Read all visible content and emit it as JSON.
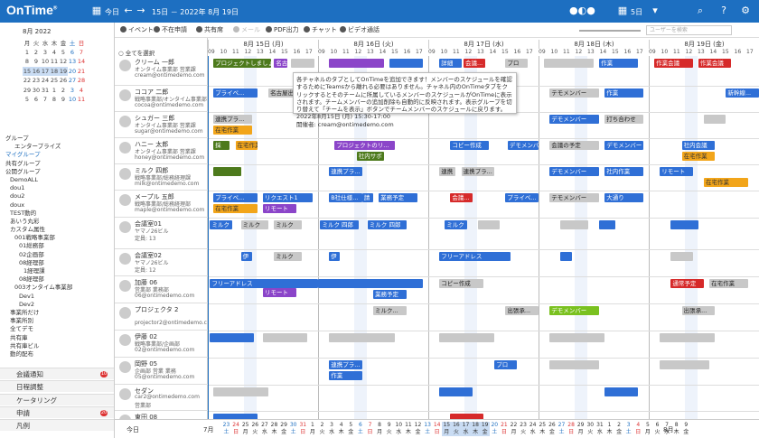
{
  "header": {
    "logo": "OnTime",
    "logo_mark": "®",
    "today": "今日",
    "range": "15日 － 2022年 8月 19日",
    "days": "5日"
  },
  "colors": {
    "header": "#1d6fc1",
    "blue": "#2f6fd6",
    "green": "#4d7a1c",
    "gray": "#999999",
    "red": "#d62a2a",
    "purple": "#8b45c9",
    "orange": "#f2a51a",
    "cyan": "#24a1cf",
    "lime": "#7ac11f"
  },
  "mini_cal": {
    "title": "8月 2022",
    "weekdays": [
      "月",
      "火",
      "水",
      "木",
      "金",
      "土",
      "日"
    ],
    "weeks": [
      [
        "1",
        "2",
        "3",
        "4",
        "5",
        "6",
        "7"
      ],
      [
        "8",
        "9",
        "10",
        "11",
        "12",
        "13",
        "14"
      ],
      [
        "15",
        "16",
        "17",
        "18",
        "19",
        "20",
        "21"
      ],
      [
        "22",
        "23",
        "24",
        "25",
        "26",
        "27",
        "28"
      ],
      [
        "29",
        "30",
        "31",
        "1",
        "2",
        "3",
        "4"
      ],
      [
        "5",
        "6",
        "7",
        "8",
        "9",
        "10",
        "11"
      ]
    ]
  },
  "tree": [
    {
      "t": "グループ",
      "i": 0
    },
    {
      "t": "エンタープライズ",
      "i": 2
    },
    {
      "t": "マイグループ",
      "i": 0
    },
    {
      "t": "共有グループ",
      "i": 0
    },
    {
      "t": "公開グループ",
      "i": 0
    },
    {
      "t": "DemoALL",
      "i": 1
    },
    {
      "t": "dou1",
      "i": 1
    },
    {
      "t": "dou2",
      "i": 1
    },
    {
      "t": "doux",
      "i": 1
    },
    {
      "t": "TEST動的",
      "i": 1
    },
    {
      "t": "あいう丸彩",
      "i": 1
    },
    {
      "t": "カスタム属性",
      "i": 1
    },
    {
      "t": "001戦略事業部",
      "i": 2
    },
    {
      "t": "01総務部",
      "i": 3
    },
    {
      "t": "02企画部",
      "i": 3
    },
    {
      "t": "08経理部",
      "i": 3
    },
    {
      "t": "1経理課",
      "i": 4
    },
    {
      "t": "08経理部",
      "i": 3
    },
    {
      "t": "003オンタイム事業部",
      "i": 2
    },
    {
      "t": "Dev1",
      "i": 3
    },
    {
      "t": "Dev2",
      "i": 3
    },
    {
      "t": "事業所だけ",
      "i": 1
    },
    {
      "t": "事業所別",
      "i": 1
    },
    {
      "t": "全てデモ",
      "i": 1
    },
    {
      "t": "共有庫",
      "i": 1
    },
    {
      "t": "共有庫ビル",
      "i": 1
    },
    {
      "t": "動的配布",
      "i": 1
    }
  ],
  "panels": [
    {
      "label": "会議通知",
      "badge": "10"
    },
    {
      "label": "日程調整",
      "badge": ""
    },
    {
      "label": "ケータリング",
      "badge": ""
    },
    {
      "label": "申請",
      "badge": "20"
    },
    {
      "label": "凡例",
      "badge": ""
    }
  ],
  "toolbar": {
    "event": "イベント",
    "absent": "不在申請",
    "shared": "共有席",
    "mail": "メール",
    "pdf": "PDF出力",
    "chat": "チャット",
    "video": "ビデオ通話",
    "search_placeholder": "ユーザーを検索"
  },
  "select_all": "全てを選択",
  "days": [
    "8月 15日 (月)",
    "8月 16日 (火)",
    "8月 17日 (水)",
    "8月 18日 (木)",
    "8月 19日 (金)"
  ],
  "hours": [
    "09",
    "10",
    "11",
    "12",
    "13",
    "14",
    "15",
    "16",
    "17"
  ],
  "users": [
    {
      "name": "クリーム 一郎",
      "sub1": "オンタイム事業部 営業課",
      "sub2": "cream@ontimedemo.com"
    },
    {
      "name": "ココア 二郎",
      "sub1": "戦略事業部/オンタイム事業部",
      "sub2": "cocoa@ontimedemo.com"
    },
    {
      "name": "シュガー 三郎",
      "sub1": "オンタイム事業部 営業課",
      "sub2": "sugar@ontimedemo.com"
    },
    {
      "name": "ハニー 太郎",
      "sub1": "オンタイム事業部 営業課",
      "sub2": "honey@ontimedemo.com"
    },
    {
      "name": "ミルク 四郎",
      "sub1": "戦略事業部/総務経理課",
      "sub2": "milk@ontimedemo.com"
    },
    {
      "name": "メープル 五郎",
      "sub1": "戦略事業部/総務経理部",
      "sub2": "maple@ontimedemo.com"
    },
    {
      "name": "会議室01",
      "sub1": "ヤマノ26ビル",
      "sub2": "定員: 13"
    },
    {
      "name": "会議室02",
      "sub1": "ヤマノ26ビル",
      "sub2": "定員: 12"
    },
    {
      "name": "加藤 06",
      "sub1": "営業部 業務部",
      "sub2": "06@ontimedemo.com"
    },
    {
      "name": "プロジェクタ 2",
      "sub1": "",
      "sub2": "projector2@ontimedemo.com"
    },
    {
      "name": "伊藤 02",
      "sub1": "戦略事業部/企画部",
      "sub2": "02@ontimedemo.com"
    },
    {
      "name": "岡野 05",
      "sub1": "企画部 営業 業務",
      "sub2": "05@ontimedemo.com"
    },
    {
      "name": "セダン",
      "sub1": "car2@ontimedemo.com",
      "sub2": "営業部"
    },
    {
      "name": "東田 08",
      "sub1": "",
      "sub2": ""
    }
  ],
  "events": [
    {
      "u": 0,
      "d": 0,
      "s": 0.05,
      "w": 0.52,
      "c": "green",
      "t": "プロジェクトしましょう"
    },
    {
      "u": 0,
      "d": 0,
      "s": 0.6,
      "w": 0.12,
      "c": "purple",
      "t": "名古..."
    },
    {
      "u": 0,
      "d": 0,
      "s": 0.75,
      "w": 0.22,
      "c": "gray",
      "t": ""
    },
    {
      "u": 0,
      "d": 1,
      "s": 0.1,
      "w": 0.5,
      "c": "purple",
      "t": ""
    },
    {
      "u": 0,
      "d": 1,
      "s": 0.65,
      "w": 0.3,
      "c": "blue",
      "t": ""
    },
    {
      "u": 0,
      "d": 2,
      "s": 0.1,
      "w": 0.2,
      "c": "blue",
      "t": "詳細"
    },
    {
      "u": 0,
      "d": 2,
      "s": 0.32,
      "w": 0.2,
      "c": "red",
      "t": "会議..."
    },
    {
      "u": 0,
      "d": 2,
      "s": 0.7,
      "w": 0.2,
      "c": "gray",
      "t": "プロ"
    },
    {
      "u": 0,
      "d": 3,
      "s": 0.05,
      "w": 0.45,
      "c": "gray",
      "t": ""
    },
    {
      "u": 0,
      "d": 3,
      "s": 0.55,
      "w": 0.35,
      "c": "blue",
      "t": "作業"
    },
    {
      "u": 0,
      "d": 4,
      "s": 0.05,
      "w": 0.35,
      "c": "red",
      "t": "作業会議"
    },
    {
      "u": 0,
      "d": 4,
      "s": 0.45,
      "w": 0.3,
      "c": "red",
      "t": "作業会議"
    },
    {
      "u": 1,
      "d": 0,
      "s": 0.05,
      "w": 0.4,
      "c": "blue",
      "t": "プライベ..."
    },
    {
      "u": 1,
      "d": 0,
      "s": 0.55,
      "w": 0.3,
      "c": "gray",
      "t": "名古屋出張"
    },
    {
      "u": 1,
      "d": 3,
      "s": 0.1,
      "w": 0.45,
      "c": "gray",
      "t": "テモメンバー"
    },
    {
      "u": 1,
      "d": 3,
      "s": 0.6,
      "w": 0.35,
      "c": "blue",
      "t": "作業"
    },
    {
      "u": 1,
      "d": 4,
      "s": 0.7,
      "w": 0.3,
      "c": "blue",
      "t": "新幹線..."
    },
    {
      "u": 2,
      "d": 0,
      "s": 0.05,
      "w": 0.35,
      "c": "gray",
      "t": "連携プラ..."
    },
    {
      "u": 2,
      "d": 0,
      "s": 0.05,
      "w": 0.35,
      "c": "orange",
      "t": "在宅作業",
      "o": 12
    },
    {
      "u": 2,
      "d": 3,
      "s": 0.1,
      "w": 0.45,
      "c": "blue",
      "t": "デモメンバー"
    },
    {
      "u": 2,
      "d": 3,
      "s": 0.6,
      "w": 0.35,
      "c": "gray",
      "t": "打ち合わせ"
    },
    {
      "u": 2,
      "d": 4,
      "s": 0.5,
      "w": 0.2,
      "c": "gray",
      "t": ""
    },
    {
      "u": 3,
      "d": 0,
      "s": 0.05,
      "w": 0.15,
      "c": "green",
      "t": "採"
    },
    {
      "u": 3,
      "d": 0,
      "s": 0.25,
      "w": 0.2,
      "c": "orange",
      "t": "在宅作業"
    },
    {
      "u": 3,
      "d": 1,
      "s": 0.15,
      "w": 0.55,
      "c": "purple",
      "t": "プロジェクトのリ..."
    },
    {
      "u": 3,
      "d": 1,
      "s": 0.35,
      "w": 0.25,
      "c": "green",
      "t": "社内サポ",
      "o": 12
    },
    {
      "u": 3,
      "d": 2,
      "s": 0.2,
      "w": 0.35,
      "c": "blue",
      "t": "コピー作成"
    },
    {
      "u": 3,
      "d": 2,
      "s": 0.72,
      "w": 0.28,
      "c": "blue",
      "t": "デモメンバー"
    },
    {
      "u": 3,
      "d": 3,
      "s": 0.1,
      "w": 0.45,
      "c": "gray",
      "t": "会議の予定"
    },
    {
      "u": 3,
      "d": 3,
      "s": 0.6,
      "w": 0.35,
      "c": "blue",
      "t": "デモメンバー"
    },
    {
      "u": 3,
      "d": 4,
      "s": 0.3,
      "w": 0.3,
      "c": "blue",
      "t": "社内会議"
    },
    {
      "u": 3,
      "d": 4,
      "s": 0.3,
      "w": 0.3,
      "c": "orange",
      "t": "在宅作業",
      "o": 12
    },
    {
      "u": 4,
      "d": 0,
      "s": 0.05,
      "w": 0.25,
      "c": "green",
      "t": ""
    },
    {
      "u": 4,
      "d": 1,
      "s": 0.1,
      "w": 0.3,
      "c": "blue",
      "t": "連携プラ..."
    },
    {
      "u": 4,
      "d": 2,
      "s": 0.1,
      "w": 0.15,
      "c": "gray",
      "t": "連携"
    },
    {
      "u": 4,
      "d": 2,
      "s": 0.3,
      "w": 0.3,
      "c": "gray",
      "t": "連携プラ..."
    },
    {
      "u": 4,
      "d": 3,
      "s": 0.1,
      "w": 0.45,
      "c": "blue",
      "t": "デモメンバー"
    },
    {
      "u": 4,
      "d": 3,
      "s": 0.6,
      "w": 0.35,
      "c": "blue",
      "t": "社内作業"
    },
    {
      "u": 4,
      "d": 4,
      "s": 0.1,
      "w": 0.3,
      "c": "blue",
      "t": "リモート"
    },
    {
      "u": 4,
      "d": 4,
      "s": 0.5,
      "w": 0.4,
      "c": "orange",
      "t": "在宅作業",
      "o": 12
    },
    {
      "u": 5,
      "d": 0,
      "s": 0.05,
      "w": 0.4,
      "c": "blue",
      "t": "プライベ..."
    },
    {
      "u": 5,
      "d": 0,
      "s": 0.5,
      "w": 0.45,
      "c": "blue",
      "t": "リクエスト1"
    },
    {
      "u": 5,
      "d": 0,
      "s": 0.05,
      "w": 0.4,
      "c": "orange",
      "t": "在宅作業",
      "o": 12
    },
    {
      "u": 5,
      "d": 0,
      "s": 0.5,
      "w": 0.3,
      "c": "purple",
      "t": "リモート",
      "o": 12
    },
    {
      "u": 5,
      "d": 1,
      "s": 0.1,
      "w": 0.3,
      "c": "blue",
      "t": "B社仕様..."
    },
    {
      "u": 5,
      "d": 1,
      "s": 0.4,
      "w": 0.1,
      "c": "blue",
      "t": "請"
    },
    {
      "u": 5,
      "d": 1,
      "s": 0.55,
      "w": 0.35,
      "c": "blue",
      "t": "業務予定"
    },
    {
      "u": 5,
      "d": 2,
      "s": 0.2,
      "w": 0.2,
      "c": "red",
      "t": "会議..."
    },
    {
      "u": 5,
      "d": 2,
      "s": 0.7,
      "w": 0.3,
      "c": "blue",
      "t": "プライベ..."
    },
    {
      "u": 5,
      "d": 3,
      "s": 0.1,
      "w": 0.45,
      "c": "gray",
      "t": "テモメンバー"
    },
    {
      "u": 5,
      "d": 3,
      "s": 0.6,
      "w": 0.35,
      "c": "blue",
      "t": "大通り"
    },
    {
      "u": 6,
      "d": 0,
      "s": 0.02,
      "w": 0.2,
      "c": "blue",
      "t": "ミルク"
    },
    {
      "u": 6,
      "d": 0,
      "s": 0.3,
      "w": 0.25,
      "c": "gray",
      "t": "ミルク"
    },
    {
      "u": 6,
      "d": 0,
      "s": 0.6,
      "w": 0.25,
      "c": "gray",
      "t": "ミルク"
    },
    {
      "u": 6,
      "d": 1,
      "s": 0.02,
      "w": 0.35,
      "c": "blue",
      "t": "ミルク 四郎"
    },
    {
      "u": 6,
      "d": 1,
      "s": 0.45,
      "w": 0.35,
      "c": "blue",
      "t": "ミルク 四郎"
    },
    {
      "u": 6,
      "d": 2,
      "s": 0.15,
      "w": 0.2,
      "c": "blue",
      "t": "ミルク"
    },
    {
      "u": 6,
      "d": 2,
      "s": 0.45,
      "w": 0.2,
      "c": "gray",
      "t": ""
    },
    {
      "u": 6,
      "d": 3,
      "s": 0.2,
      "w": 0.25,
      "c": "gray",
      "t": ""
    },
    {
      "u": 6,
      "d": 3,
      "s": 0.55,
      "w": 0.15,
      "c": "blue",
      "t": ""
    },
    {
      "u": 6,
      "d": 4,
      "s": 0.2,
      "w": 0.25,
      "c": "blue",
      "t": ""
    },
    {
      "u": 7,
      "d": 0,
      "s": 0.3,
      "w": 0.1,
      "c": "blue",
      "t": "伊"
    },
    {
      "u": 7,
      "d": 0,
      "s": 0.6,
      "w": 0.25,
      "c": "gray",
      "t": "ミルク"
    },
    {
      "u": 7,
      "d": 1,
      "s": 0.1,
      "w": 0.1,
      "c": "blue",
      "t": "伊"
    },
    {
      "u": 7,
      "d": 2,
      "s": 0.1,
      "w": 0.65,
      "c": "blue",
      "t": "フリーアドレス"
    },
    {
      "u": 7,
      "d": 3,
      "s": 0.2,
      "w": 0.1,
      "c": "blue",
      "t": ""
    },
    {
      "u": 7,
      "d": 4,
      "s": 0.2,
      "w": 0.2,
      "c": "gray",
      "t": ""
    },
    {
      "u": 8,
      "d": 0,
      "s": 0.02,
      "w": 0.98,
      "c": "blue",
      "t": "フリーアドレス"
    },
    {
      "u": 8,
      "d": 1,
      "s": 0.0,
      "w": 0.95,
      "c": "blue",
      "t": ""
    },
    {
      "u": 8,
      "d": 2,
      "s": 0.1,
      "w": 0.4,
      "c": "gray",
      "t": "コピー作成"
    },
    {
      "u": 8,
      "d": 0,
      "s": 0.5,
      "w": 0.3,
      "c": "purple",
      "t": "リモート",
      "o": 10
    },
    {
      "u": 8,
      "d": 1,
      "s": 0.5,
      "w": 0.3,
      "c": "blue",
      "t": "業務予定",
      "o": 12
    },
    {
      "u": 8,
      "d": 4,
      "s": 0.2,
      "w": 0.3,
      "c": "red",
      "t": "通常予定"
    },
    {
      "u": 8,
      "d": 4,
      "s": 0.55,
      "w": 0.35,
      "c": "gray",
      "t": "在宅作業"
    },
    {
      "u": 9,
      "d": 1,
      "s": 0.5,
      "w": 0.3,
      "c": "gray",
      "t": "ミルク..."
    },
    {
      "u": 9,
      "d": 2,
      "s": 0.7,
      "w": 0.3,
      "c": "gray",
      "t": "出張承..."
    },
    {
      "u": 9,
      "d": 3,
      "s": 0.1,
      "w": 0.45,
      "c": "lime",
      "t": "デモメンバー"
    },
    {
      "u": 9,
      "d": 4,
      "s": 0.3,
      "w": 0.3,
      "c": "gray",
      "t": "出張承..."
    },
    {
      "u": 10,
      "d": 0,
      "s": 0.02,
      "w": 0.4,
      "c": "blue",
      "t": ""
    },
    {
      "u": 10,
      "d": 0,
      "s": 0.5,
      "w": 0.4,
      "c": "gray",
      "t": ""
    },
    {
      "u": 10,
      "d": 1,
      "s": 0.1,
      "w": 0.6,
      "c": "gray",
      "t": ""
    },
    {
      "u": 10,
      "d": 2,
      "s": 0.1,
      "w": 0.5,
      "c": "gray",
      "t": ""
    },
    {
      "u": 10,
      "d": 3,
      "s": 0.1,
      "w": 0.5,
      "c": "gray",
      "t": ""
    },
    {
      "u": 10,
      "d": 4,
      "s": 0.1,
      "w": 0.5,
      "c": "gray",
      "t": ""
    },
    {
      "u": 11,
      "d": 1,
      "s": 0.1,
      "w": 0.3,
      "c": "blue",
      "t": "連携プラ..."
    },
    {
      "u": 11,
      "d": 1,
      "s": 0.1,
      "w": 0.3,
      "c": "blue",
      "t": "作業",
      "o": 12
    },
    {
      "u": 11,
      "d": 2,
      "s": 0.6,
      "w": 0.2,
      "c": "blue",
      "t": "プロ"
    },
    {
      "u": 11,
      "d": 3,
      "s": 0.1,
      "w": 0.45,
      "c": "gray",
      "t": ""
    },
    {
      "u": 11,
      "d": 4,
      "s": 0.1,
      "w": 0.45,
      "c": "gray",
      "t": ""
    },
    {
      "u": 12,
      "d": 0,
      "s": 0.05,
      "w": 0.5,
      "c": "gray",
      "t": ""
    },
    {
      "u": 12,
      "d": 2,
      "s": 0.1,
      "w": 0.3,
      "c": "blue",
      "t": ""
    },
    {
      "u": 12,
      "d": 3,
      "s": 0.6,
      "w": 0.3,
      "c": "blue",
      "t": ""
    },
    {
      "u": 13,
      "d": 0,
      "s": 0.05,
      "w": 0.4,
      "c": "blue",
      "t": ""
    },
    {
      "u": 13,
      "d": 2,
      "s": 0.2,
      "w": 0.3,
      "c": "red",
      "t": ""
    }
  ],
  "tooltip": {
    "line1": "各チャネルのタブとしてOnTimeを追加できます！メンバーのスケジュールを確認するためにTeamsから離れる必要はありません。チャネル内のOnTimeタブをクリックするとそのチームに所属しているメンバーのスケジュールがOnTimeに表示されます。チームメンバーの追加削除も自動的に反映されます。表示グループを切り替えて「チームを表示」ボタンでチームメンバーのスケジュールに戻ります。",
    "line2": "2022年8月15日 (月) 15:30-17:00",
    "line3": "開催者: cream@ontimedemo.com"
  },
  "footer": {
    "today": "今日",
    "month1": "7月",
    "month2": "8月",
    "dates": [
      {
        "d": "23",
        "w": "土"
      },
      {
        "d": "24",
        "w": "日"
      },
      {
        "d": "25",
        "w": "月"
      },
      {
        "d": "26",
        "w": "火"
      },
      {
        "d": "27",
        "w": "水"
      },
      {
        "d": "28",
        "w": "木"
      },
      {
        "d": "29",
        "w": "金"
      },
      {
        "d": "30",
        "w": "土"
      },
      {
        "d": "31",
        "w": "日"
      },
      {
        "d": "1",
        "w": "月"
      },
      {
        "d": "2",
        "w": "火"
      },
      {
        "d": "3",
        "w": "水"
      },
      {
        "d": "4",
        "w": "木"
      },
      {
        "d": "5",
        "w": "金"
      },
      {
        "d": "6",
        "w": "土"
      },
      {
        "d": "7",
        "w": "日"
      },
      {
        "d": "8",
        "w": "月"
      },
      {
        "d": "9",
        "w": "火"
      },
      {
        "d": "10",
        "w": "水"
      },
      {
        "d": "11",
        "w": "木"
      },
      {
        "d": "12",
        "w": "金"
      },
      {
        "d": "13",
        "w": "土"
      },
      {
        "d": "14",
        "w": "日"
      },
      {
        "d": "15",
        "w": "月"
      },
      {
        "d": "16",
        "w": "火"
      },
      {
        "d": "17",
        "w": "水"
      },
      {
        "d": "18",
        "w": "木"
      },
      {
        "d": "19",
        "w": "金"
      },
      {
        "d": "20",
        "w": "土"
      },
      {
        "d": "21",
        "w": "日"
      },
      {
        "d": "22",
        "w": "月"
      },
      {
        "d": "23",
        "w": "火"
      },
      {
        "d": "24",
        "w": "水"
      },
      {
        "d": "25",
        "w": "木"
      },
      {
        "d": "26",
        "w": "金"
      },
      {
        "d": "27",
        "w": "土"
      },
      {
        "d": "28",
        "w": "日"
      },
      {
        "d": "29",
        "w": "月"
      },
      {
        "d": "30",
        "w": "火"
      },
      {
        "d": "31",
        "w": "水"
      },
      {
        "d": "1",
        "w": "木"
      },
      {
        "d": "2",
        "w": "金"
      },
      {
        "d": "3",
        "w": "土"
      },
      {
        "d": "4",
        "w": "日"
      },
      {
        "d": "5",
        "w": "月"
      },
      {
        "d": "6",
        "w": "火"
      },
      {
        "d": "7",
        "w": "水"
      },
      {
        "d": "8",
        "w": "木"
      },
      {
        "d": "9",
        "w": "金"
      }
    ]
  }
}
